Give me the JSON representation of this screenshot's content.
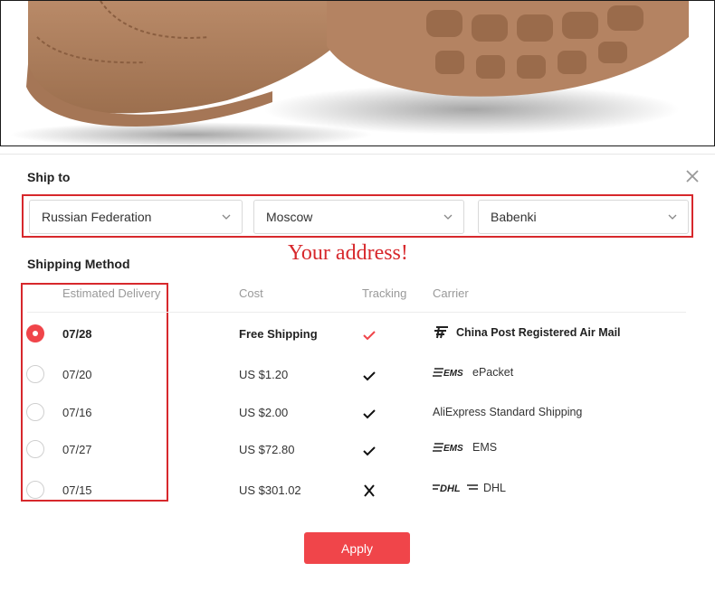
{
  "product": {
    "image_icon": "boot-photo-icon"
  },
  "ship_to": {
    "title": "Ship to",
    "close_icon": "close-icon",
    "country": "Russian Federation",
    "city": "Moscow",
    "village": "Babenki",
    "annotation": "Your address!"
  },
  "shipping": {
    "title": "Shipping Method",
    "headers": {
      "delivery": "Estimated Delivery",
      "cost": "Cost",
      "tracking": "Tracking",
      "carrier": "Carrier"
    },
    "options": [
      {
        "date": "07/28",
        "cost": "Free Shipping",
        "tracking": true,
        "carrier": "China Post Registered Air Mail",
        "carrier_logo": "china-post-logo-icon",
        "selected": true
      },
      {
        "date": "07/20",
        "cost": "US $1.20",
        "tracking": true,
        "carrier": "ePacket",
        "carrier_logo": "ems-logo-icon",
        "selected": false
      },
      {
        "date": "07/16",
        "cost": "US $2.00",
        "tracking": true,
        "carrier": "AliExpress Standard Shipping",
        "carrier_logo": "",
        "selected": false
      },
      {
        "date": "07/27",
        "cost": "US $72.80",
        "tracking": true,
        "carrier": "EMS",
        "carrier_logo": "ems-logo-icon",
        "selected": false
      },
      {
        "date": "07/15",
        "cost": "US $301.02",
        "tracking": false,
        "carrier": "DHL",
        "carrier_logo": "dhl-logo-icon",
        "selected": false
      }
    ]
  },
  "apply_label": "Apply",
  "colors": {
    "accent": "#f0454a",
    "annotation_red": "#d7282c",
    "check_selected": "#f0454a"
  }
}
